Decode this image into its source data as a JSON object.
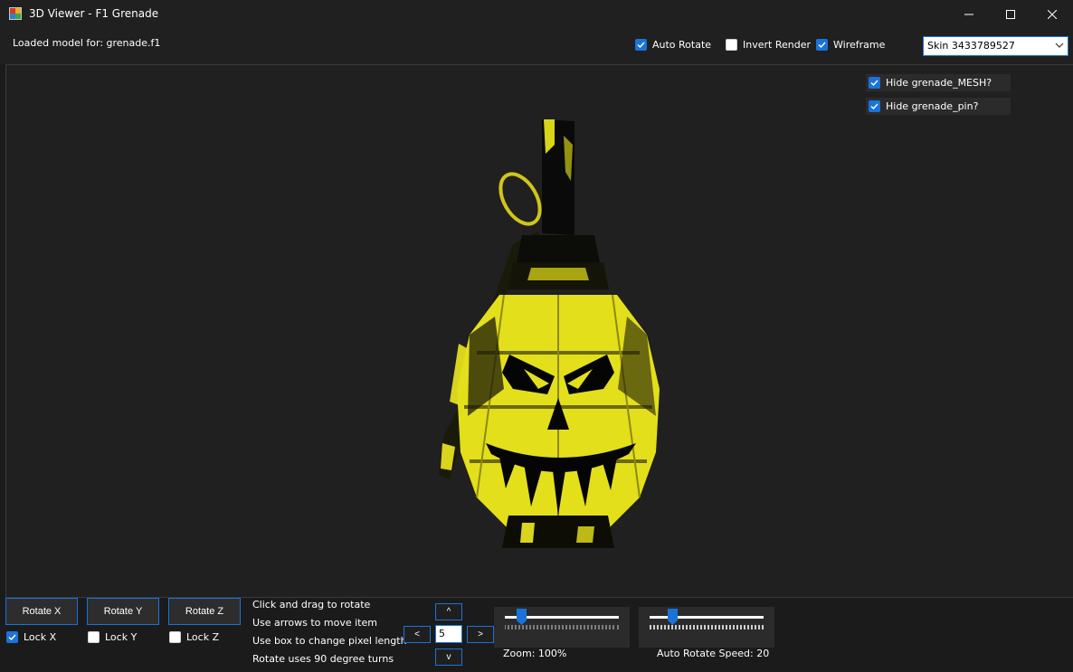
{
  "window": {
    "title": "3D Viewer - F1 Grenade",
    "icons": [
      "app-icon",
      "minimize-icon",
      "maximize-icon",
      "close-icon"
    ]
  },
  "topbar": {
    "loaded_label": "Loaded model for: grenade.f1",
    "auto_rotate": {
      "label": "Auto Rotate",
      "checked": true
    },
    "invert_render": {
      "label": "Invert Render",
      "checked": false
    },
    "wireframe": {
      "label": "Wireframe",
      "checked": true
    },
    "skin_select": {
      "value": "Skin 3433789527"
    }
  },
  "viewport": {
    "hide_mesh": {
      "label": "Hide grenade_MESH?",
      "checked": true
    },
    "hide_pin": {
      "label": "Hide grenade_pin?",
      "checked": true
    }
  },
  "bottom": {
    "rotate_x": "Rotate X",
    "rotate_y": "Rotate Y",
    "rotate_z": "Rotate Z",
    "lock_x": {
      "label": "Lock X",
      "checked": true
    },
    "lock_y": {
      "label": "Lock Y",
      "checked": false
    },
    "lock_z": {
      "label": "Lock Z",
      "checked": false
    },
    "hints": [
      "Click and drag to rotate",
      "Use arrows to move item",
      "Use box to change pixel length",
      "Rotate uses 90 degree turns"
    ],
    "arrows": {
      "up": "^",
      "left": "<",
      "right": ">",
      "down": "v"
    },
    "pixel_length": "5",
    "zoom": {
      "label": "Zoom: 100%",
      "level": 0.15
    },
    "auto_rotate_speed": {
      "label": "Auto Rotate Speed: 20",
      "level": 0.2
    }
  },
  "colors": {
    "accent": "#1a73d9",
    "model_yellow": "#e6e21a",
    "background": "#202020"
  }
}
